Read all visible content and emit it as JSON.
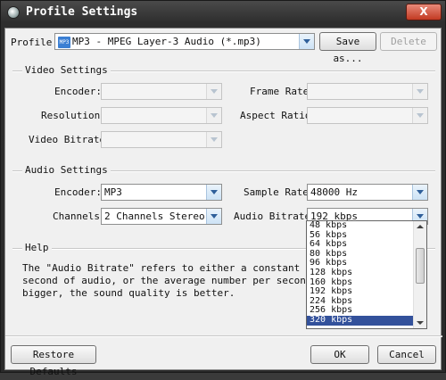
{
  "window": {
    "title": "Profile Settings",
    "close_label": "X"
  },
  "profile": {
    "label": "Profile:",
    "value": "MP3 - MPEG Layer-3 Audio (*.mp3)",
    "icon": "mp3-file-icon",
    "save_as_label": "Save as...",
    "delete_label": "Delete"
  },
  "video": {
    "group_title": "Video Settings",
    "encoder_label": "Encoder:",
    "resolution_label": "Resolution:",
    "bitrate_label": "Video Bitrate:",
    "frame_rate_label": "Frame Rate:",
    "aspect_ratio_label": "Aspect Ratio:"
  },
  "audio": {
    "group_title": "Audio Settings",
    "encoder_label": "Encoder:",
    "encoder_value": "MP3",
    "channels_label": "Channels:",
    "channels_value": "2 Channels Stereo",
    "sample_rate_label": "Sample Rate:",
    "sample_rate_value": "48000 Hz",
    "bitrate_label": "Audio Bitrate:",
    "bitrate_value": "192 kbps"
  },
  "bitrate_options": [
    "48 kbps",
    "56 kbps",
    "64 kbps",
    "80 kbps",
    "96 kbps",
    "128 kbps",
    "160 kbps",
    "192 kbps",
    "224 kbps",
    "256 kbps",
    "320 kbps"
  ],
  "bitrate_selected": "320 kbps",
  "help": {
    "group_title": "Help",
    "line1": "The \"Audio Bitrate\" refers to either a constant number of bi",
    "line2": "second of audio, or the average number per second (in kbit/s",
    "line3": "bigger, the sound quality is better."
  },
  "footer": {
    "restore_label": "Restore Defaults",
    "ok_label": "OK",
    "cancel_label": "Cancel"
  }
}
